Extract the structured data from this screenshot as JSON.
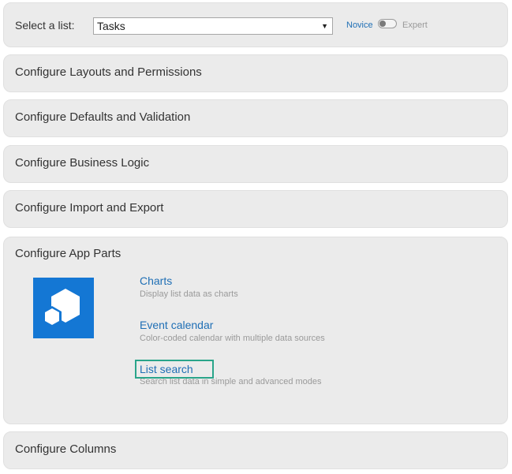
{
  "select_list": {
    "label": "Select a list:",
    "value": "Tasks",
    "mode_novice": "Novice",
    "mode_expert": "Expert"
  },
  "sections": {
    "layouts": "Configure Layouts and Permissions",
    "defaults": "Configure Defaults and Validation",
    "logic": "Configure Business Logic",
    "import": "Configure Import and Export",
    "app_parts": "Configure App Parts",
    "columns": "Configure Columns"
  },
  "app_parts": [
    {
      "title": "Charts",
      "description": "Display list data as charts"
    },
    {
      "title": "Event calendar",
      "description": "Color-coded calendar with multiple data sources"
    },
    {
      "title": "List search",
      "description": "Search list data in simple and advanced modes"
    }
  ],
  "colors": {
    "accent": "#1f6fb5",
    "tile": "#1477d4",
    "highlight": "#2aa58a",
    "panel": "#ebebeb"
  }
}
